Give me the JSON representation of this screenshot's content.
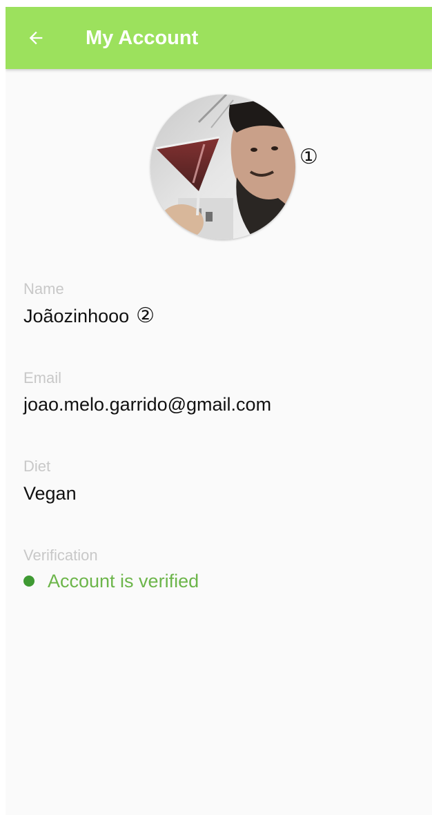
{
  "appbar": {
    "title": "My Account",
    "back_icon": "arrow-left-icon",
    "background": "#9ce15d"
  },
  "profile": {
    "avatar_icon": "profile-photo",
    "marker_avatar": "①"
  },
  "fields": {
    "name": {
      "label": "Name",
      "value": "Joãozinhooo",
      "marker": "②"
    },
    "email": {
      "label": "Email",
      "value": "joao.melo.garrido@gmail.com"
    },
    "diet": {
      "label": "Diet",
      "value": "Vegan"
    },
    "verification": {
      "label": "Verification",
      "value": "Account is verified",
      "status_color": "#3f9a33",
      "text_color": "#6cb54a"
    }
  }
}
